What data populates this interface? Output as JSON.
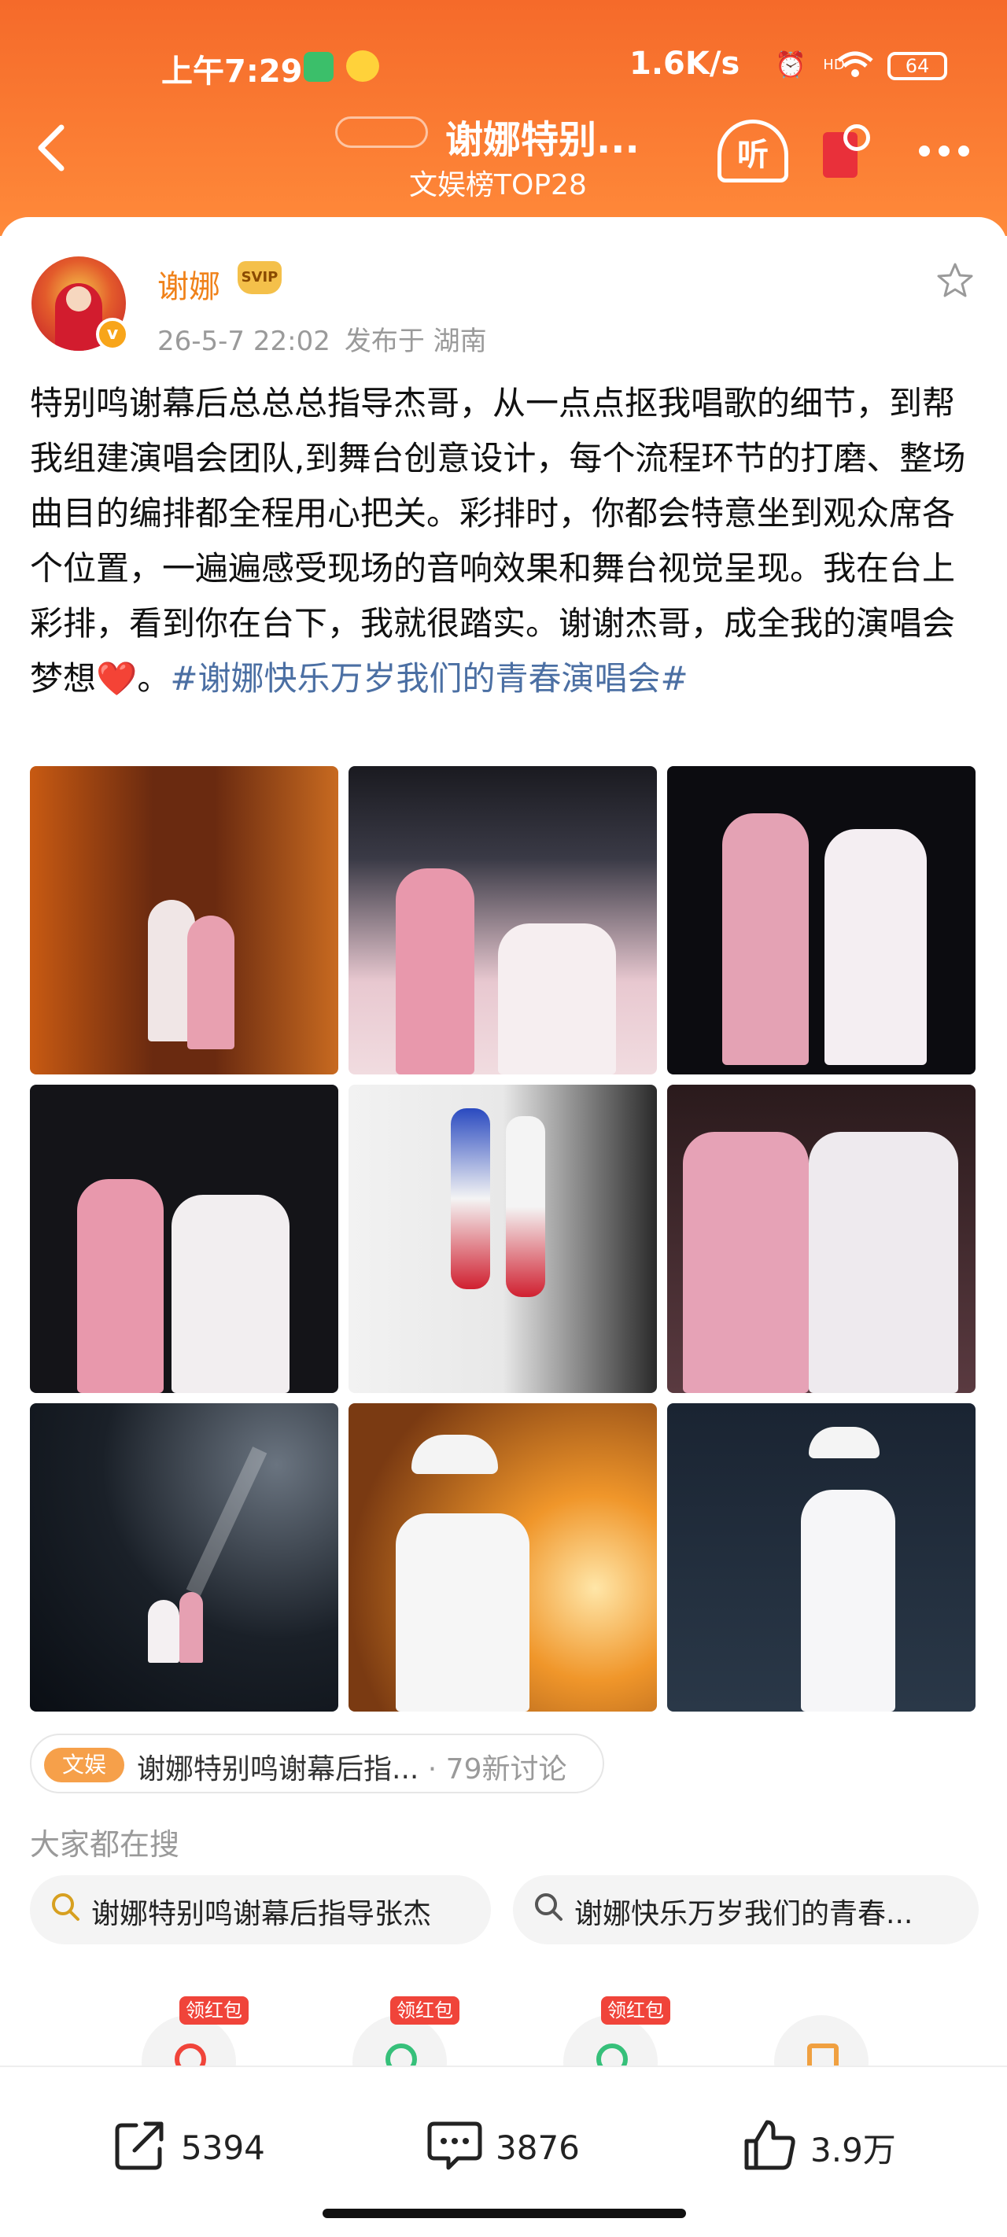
{
  "status_bar": {
    "time": "上午7:29",
    "network_speed": "1.6K/s",
    "hd_label": "HD",
    "battery": "64"
  },
  "nav": {
    "title": "谢娜特别...",
    "subtitle": "文娱榜TOP28",
    "listen_label": "听"
  },
  "post": {
    "author": "谢娜",
    "vip_label": "SVIP",
    "date": "26-5-7 22:02",
    "location": "发布于 湖南",
    "text_main": "特别鸣谢幕后总总总指导杰哥，从一点点抠我唱歌的细节，到帮我组建演唱会团队,到舞台创意设计，每个流程环节的打磨、整场曲目的编排都全程用心把关。彩排时，你都会特意坐到观众席各个位置，一遍遍感受现场的音响效果和舞台视觉呈现。我在台上彩排，看到你在台下，我就很踏实。谢谢杰哥，成全我的演唱会梦想",
    "heart": "❤️",
    "text_after": "。",
    "hashtag": "#谢娜快乐万岁我们的青春演唱会#"
  },
  "photos": [
    "photo-1",
    "photo-2",
    "photo-3",
    "photo-4",
    "photo-5",
    "photo-6",
    "photo-7",
    "photo-8",
    "photo-9"
  ],
  "topic": {
    "badge": "文娱",
    "text": "谢娜特别鸣谢幕后指...",
    "count": "· 79新讨论"
  },
  "search": {
    "heading": "大家都在搜",
    "suggestions": [
      {
        "icon": "hot-search-icon",
        "text": "谢娜特别鸣谢幕后指导张杰"
      },
      {
        "icon": "search-icon",
        "text": "谢娜快乐万岁我们的青春..."
      }
    ]
  },
  "promos": [
    {
      "tag": "领红包"
    },
    {
      "tag": "领红包"
    },
    {
      "tag": "领红包"
    },
    {
      "tag": ""
    }
  ],
  "actions": {
    "share_count": "5394",
    "comment_count": "3876",
    "like_count": "3.9万"
  },
  "colors": {
    "header_orange": "#f56a2a",
    "author_orange": "#f0821a",
    "hashtag_blue": "#4b6fa3",
    "red_tag": "#f0443a"
  }
}
